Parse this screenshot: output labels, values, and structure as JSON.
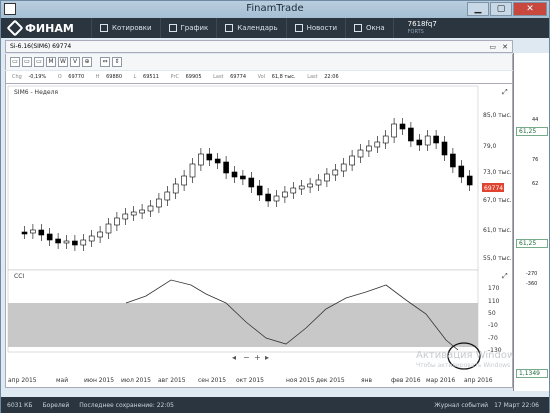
{
  "window": {
    "title": "FinamTrade"
  },
  "menubar": {
    "brand": "ФИНАМ",
    "items": [
      "Котировки",
      "График",
      "Календарь",
      "Новости",
      "Окна"
    ],
    "account": "7618fq7",
    "account_sub": "FORTS"
  },
  "tab": {
    "title": "Si-6.16(SIM6) 69774"
  },
  "toolbar": {
    "buttons": [
      "▭",
      "▭",
      "▭",
      "M",
      "W",
      "V",
      "⊕",
      "⇔",
      "⇕"
    ]
  },
  "infobar": {
    "chg_label": "Chg",
    "chg": "-0,19%",
    "o_label": "O",
    "o": "69770",
    "h_label": "H",
    "h": "69880",
    "l_label": "L",
    "l": "69511",
    "prc_label": "PrC",
    "prc": "69905",
    "last_label": "Last",
    "last": "69774",
    "vol_label": "Vol",
    "vol": "61,8 тыс.",
    "time_label": "Last",
    "time": "22:06"
  },
  "price_pane": {
    "symbol": "SIM6 - Неделя",
    "ticks": [
      "85,0 тыс.",
      "79,0",
      "73,0 тыс.",
      "67,0 тыс.",
      "61,0 тыс.",
      "55,0 тыс."
    ],
    "last_tag": "69774"
  },
  "cci_pane": {
    "label": "CCI",
    "ticks": [
      "170",
      "110",
      "50",
      "-10",
      "-70",
      "-130"
    ]
  },
  "x_labels": [
    "апр 2015",
    "май",
    "июн 2015",
    "июл 2015",
    "авг 2015",
    "сен 2015",
    "окт 2015",
    "ноя 2015",
    "дек 2015",
    "янв",
    "фев 2016",
    "мар 2016",
    "апр 2016"
  ],
  "sidepanel": {
    "p1": "44",
    "p1b": "61,25",
    "p2": "76",
    "p3": "62",
    "p4": "61,25",
    "p5": "-270",
    "p6": "-360",
    "p7": "1,1349"
  },
  "watermark": {
    "line1": "Активация Windows",
    "line2": "Чтобы активировать Windows"
  },
  "statusbar": {
    "speed": "6031 КБ",
    "status": "Борелей",
    "autosave": "Последнее сохранение: 22:05",
    "journal": "Журнал событий",
    "date": "17 Март 22:06"
  },
  "colors": {
    "up": "#ffffff",
    "down": "#000000",
    "accent": "#e0432f",
    "menubg": "#2b3540"
  }
}
